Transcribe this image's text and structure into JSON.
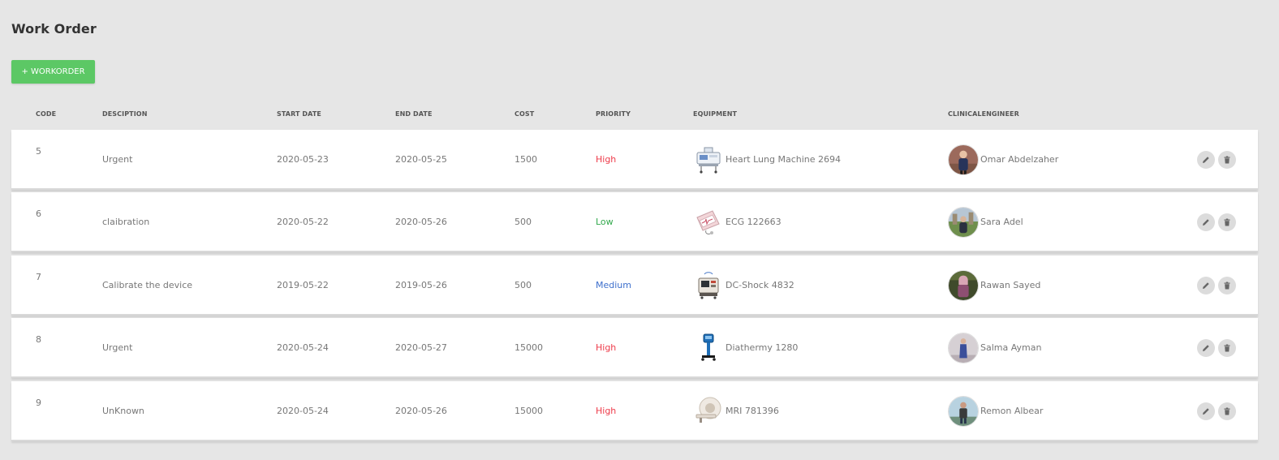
{
  "page": {
    "title": "Work Order"
  },
  "toolbar": {
    "add_label": "+ WORKORDER"
  },
  "colors": {
    "accent_green": "#5cc865",
    "high": "#ee3b4a",
    "low": "#33a94d",
    "medium": "#3d6fcc"
  },
  "table": {
    "headers": {
      "code": "CODE",
      "description": "DESCIPTION",
      "start": "START DATE",
      "end": "END DATE",
      "cost": "COST",
      "priority": "PRIORITY",
      "equipment": "EQUIPMENT",
      "engineer": "CLINICALENGINEER"
    },
    "rows": [
      {
        "code": "5",
        "description": "Urgent",
        "start": "2020-05-23",
        "end": "2020-05-25",
        "cost": "1500",
        "priority": "High",
        "equipment": "Heart Lung Machine 2694",
        "equipment_icon": "heart-lung-machine-image",
        "engineer": "Omar Abdelzaher"
      },
      {
        "code": "6",
        "description": "claibration",
        "start": "2020-05-22",
        "end": "2020-05-26",
        "cost": "500",
        "priority": "Low",
        "equipment": "ECG 122663",
        "equipment_icon": "ecg-machine-image",
        "engineer": "Sara Adel"
      },
      {
        "code": "7",
        "description": "Calibrate the device",
        "start": "2019-05-22",
        "end": "2019-05-26",
        "cost": "500",
        "priority": "Medium",
        "equipment": "DC-Shock 4832",
        "equipment_icon": "defibrillator-image",
        "engineer": "Rawan Sayed"
      },
      {
        "code": "8",
        "description": "Urgent",
        "start": "2020-05-24",
        "end": "2020-05-27",
        "cost": "15000",
        "priority": "High",
        "equipment": "Diathermy 1280",
        "equipment_icon": "diathermy-image",
        "engineer": "Salma Ayman"
      },
      {
        "code": "9",
        "description": "UnKnown",
        "start": "2020-05-24",
        "end": "2020-05-26",
        "cost": "15000",
        "priority": "High",
        "equipment": "MRI 781396",
        "equipment_icon": "mri-scanner-image",
        "engineer": "Remon Albear"
      }
    ],
    "row_actions": {
      "edit_icon": "pencil-icon",
      "delete_icon": "trash-icon"
    }
  }
}
